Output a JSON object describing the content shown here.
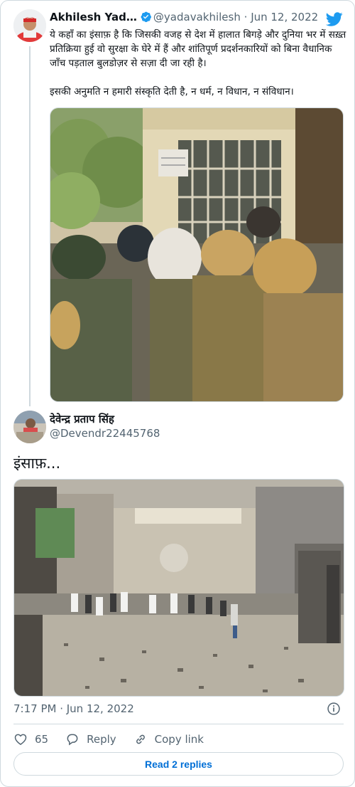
{
  "tweet": {
    "author_name": "Akhilesh Yad…",
    "handle": "@yadavakhilesh",
    "separator": "·",
    "date": "Jun 12, 2022",
    "paragraph1": "ये कहाँ का इंसाफ़ है कि जिसकी वजह से देश में हालात बिगड़े और दुनिया भर में सख़्त प्रतिक्रिया हुई वो सुरक्षा के घेरे में हैं और शांतिपूर्ण प्रदर्शनकारियों को बिना वैधानिक जाँच पड़ताल बुलडोज़र से सज़ा दी जा रही है।",
    "paragraph2": "इसकी अनुमति न हमारी संस्कृति देती है, न धर्म, न विधान, न संविधान।"
  },
  "reply": {
    "author_name": "देवेन्द्र प्रताप सिंह",
    "handle": "@Devendr22445768",
    "text": "इंसाफ़..."
  },
  "meta": {
    "timestamp": "7:17 PM · Jun 12, 2022"
  },
  "actions": {
    "like_count": "65",
    "reply_label": "Reply",
    "copy_label": "Copy link"
  },
  "footer": {
    "read_replies": "Read 2 replies"
  },
  "icons": {
    "logo": "twitter-bird-icon",
    "verified": "verified-badge-icon",
    "info": "info-icon",
    "like": "heart-icon",
    "reply": "reply-bubble-icon",
    "copy": "link-icon"
  },
  "colors": {
    "brand_blue": "#1d9bf0",
    "link_blue": "#006fd6",
    "secondary_text": "#536471",
    "border": "#cfd9de"
  }
}
